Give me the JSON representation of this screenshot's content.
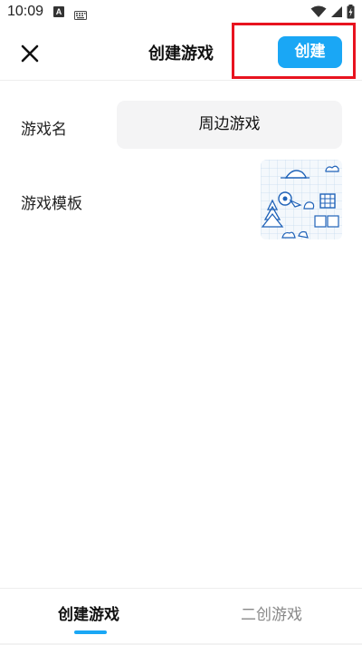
{
  "status_bar": {
    "time": "10:09",
    "notification_badge": "A",
    "icons": [
      "android-notification-icon",
      "keyboard-icon",
      "wifi-icon",
      "signal-icon",
      "battery-charging-icon"
    ]
  },
  "header": {
    "title": "创建游戏",
    "close_icon": "close-icon",
    "create_label": "创建",
    "accent_color": "#1aa7f5",
    "highlight_color": "#e8131f"
  },
  "form": {
    "name_label": "游戏名",
    "name_value": "周边游戏",
    "template_label": "游戏模板",
    "template_thumbnail_icon": "doodle-template-thumbnail"
  },
  "tabs": {
    "items": [
      {
        "label": "创建游戏",
        "active": true
      },
      {
        "label": "二创游戏",
        "active": false
      }
    ]
  }
}
